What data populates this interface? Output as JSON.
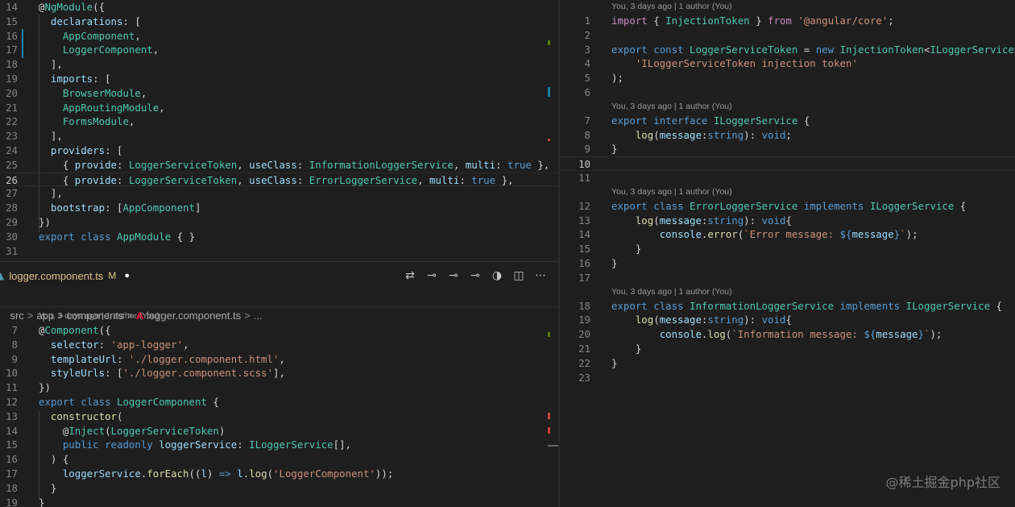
{
  "top_pane": {
    "lines": [
      {
        "n": "14",
        "text": "@NgModule({"
      },
      {
        "n": "15",
        "text": "  declarations: ["
      },
      {
        "n": "16",
        "text": "    AppComponent,"
      },
      {
        "n": "17",
        "text": "    LoggerComponent,"
      },
      {
        "n": "18",
        "text": "  ],"
      },
      {
        "n": "19",
        "text": "  imports: ["
      },
      {
        "n": "20",
        "text": "    BrowserModule,"
      },
      {
        "n": "21",
        "text": "    AppRoutingModule,"
      },
      {
        "n": "22",
        "text": "    FormsModule,"
      },
      {
        "n": "23",
        "text": "  ],"
      },
      {
        "n": "24",
        "text": "  providers: ["
      },
      {
        "n": "25",
        "text": "    { provide: LoggerServiceToken, useClass: InformationLoggerService, multi: true },"
      },
      {
        "n": "26",
        "text": "    { provide: LoggerServiceToken, useClass: ErrorLoggerService, multi: true },"
      },
      {
        "n": "27",
        "text": "  ],"
      },
      {
        "n": "28",
        "text": "  bootstrap: [AppComponent]"
      },
      {
        "n": "29",
        "text": "})"
      },
      {
        "n": "30",
        "text": "export class AppModule { }"
      },
      {
        "n": "31",
        "text": ""
      }
    ]
  },
  "editor_tab": {
    "filename": "logger.component.ts",
    "modified_badge": "M",
    "unsaved_dot": "●",
    "icon": "angular-icon"
  },
  "editor_actions": [
    {
      "name": "open-changes-icon",
      "glyph": "⇄"
    },
    {
      "name": "prev-change-icon",
      "glyph": "⊸"
    },
    {
      "name": "timeline-icon",
      "glyph": "⊸"
    },
    {
      "name": "next-change-icon",
      "glyph": "⊸"
    },
    {
      "name": "git-compare-icon",
      "glyph": "◑"
    },
    {
      "name": "split-editor-icon",
      "glyph": "◫"
    },
    {
      "name": "more-actions-icon",
      "glyph": "⋯"
    }
  ],
  "breadcrumbs": {
    "items": [
      "src",
      "app",
      "components",
      "logger.component.ts",
      "..."
    ],
    "separator": ">"
  },
  "bottom_pane": {
    "lens": "You, 3 days ago | 1 author (You)",
    "lines": [
      {
        "n": "7",
        "text": "@Component({"
      },
      {
        "n": "8",
        "text": "  selector: 'app-logger',"
      },
      {
        "n": "9",
        "text": "  templateUrl: './logger.component.html',"
      },
      {
        "n": "10",
        "text": "  styleUrls: ['./logger.component.scss'],"
      },
      {
        "n": "11",
        "text": "})"
      },
      {
        "n": "12",
        "text": "export class LoggerComponent {"
      },
      {
        "n": "13",
        "text": "  constructor("
      },
      {
        "n": "14",
        "text": "    @Inject(LoggerServiceToken)"
      },
      {
        "n": "15",
        "text": "    public readonly loggerService: ILoggerService[],"
      },
      {
        "n": "16",
        "text": "  ) {"
      },
      {
        "n": "17",
        "text": "    loggerService.forEach((l) => l.log('LoggerComponent'));"
      },
      {
        "n": "18",
        "text": "  }"
      },
      {
        "n": "19",
        "text": "}"
      }
    ]
  },
  "right_pane": {
    "lens": "You, 3 days ago | 1 author (You)",
    "lines": [
      {
        "n": "1",
        "text": "import { InjectionToken } from '@angular/core';"
      },
      {
        "n": "2",
        "text": ""
      },
      {
        "n": "3",
        "text": "export const LoggerServiceToken = new InjectionToken<ILoggerService>("
      },
      {
        "n": "4",
        "text": "    'ILoggerServiceToken injection token'"
      },
      {
        "n": "5",
        "text": ");"
      },
      {
        "n": "6",
        "text": ""
      },
      {
        "n": "7",
        "text": "export interface ILoggerService {"
      },
      {
        "n": "8",
        "text": "    log(message:string): void;"
      },
      {
        "n": "9",
        "text": "}"
      },
      {
        "n": "10",
        "text": ""
      },
      {
        "n": "11",
        "text": ""
      },
      {
        "n": "12",
        "text": "export class ErrorLoggerService implements ILoggerService {"
      },
      {
        "n": "13",
        "text": "    log(message:string): void{"
      },
      {
        "n": "14",
        "text": "        console.error(`Error message: ${message}`);"
      },
      {
        "n": "15",
        "text": "    }"
      },
      {
        "n": "16",
        "text": "}"
      },
      {
        "n": "17",
        "text": ""
      },
      {
        "n": "18",
        "text": "export class InformationLoggerService implements ILoggerService {"
      },
      {
        "n": "19",
        "text": "    log(message:string): void{"
      },
      {
        "n": "20",
        "text": "        console.log(`Information message: ${message}`);"
      },
      {
        "n": "21",
        "text": "    }"
      },
      {
        "n": "22",
        "text": "}"
      },
      {
        "n": "23",
        "text": ""
      }
    ]
  },
  "watermark": "@稀土掘金php社区",
  "colors": {
    "background": "#1e1e1e",
    "keyword": "#569cd6",
    "control_keyword": "#c586c0",
    "type": "#4ec9b0",
    "variable": "#9cdcfe",
    "string": "#ce9178",
    "function": "#dcdcaa",
    "modified_file": "#e2c08d"
  }
}
